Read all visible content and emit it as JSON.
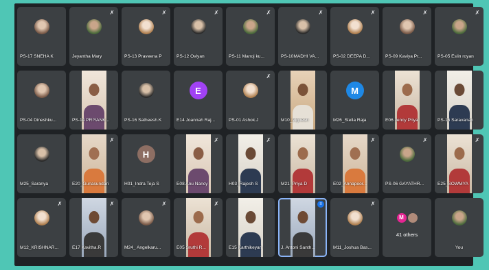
{
  "tiles": [
    {
      "name": "PS-17 SNEHA K",
      "kind": "avatar",
      "style": "photo1",
      "mic": ""
    },
    {
      "name": "Jeyantha Mary",
      "kind": "avatar",
      "style": "photo3",
      "mic": "muted"
    },
    {
      "name": "PS-13 Praveena P",
      "kind": "avatar",
      "style": "photo2",
      "mic": "muted"
    },
    {
      "name": "PS-12 Oviyan",
      "kind": "avatar",
      "style": "photo4",
      "mic": "muted"
    },
    {
      "name": "PS-11 Manoj ku...",
      "kind": "avatar",
      "style": "photo3",
      "mic": "muted"
    },
    {
      "name": "PS-10MADHI VA...",
      "kind": "avatar",
      "style": "photo4",
      "mic": "muted"
    },
    {
      "name": "PS-02 DEEPA D...",
      "kind": "avatar",
      "style": "photo2",
      "mic": "muted"
    },
    {
      "name": "PS-09 Kaviya Pr...",
      "kind": "avatar",
      "style": "photo1",
      "mic": "muted"
    },
    {
      "name": "PS-05 Eslin royan",
      "kind": "avatar",
      "style": "photo3",
      "mic": "muted"
    },
    {
      "name": "PS-04 Dineshku...",
      "kind": "avatar",
      "style": "photo1",
      "mic": ""
    },
    {
      "name": "PS-14 PRIYANK...",
      "kind": "video",
      "style": "v-b",
      "mic": ""
    },
    {
      "name": "PS-16 Satheesh.K",
      "kind": "avatar",
      "style": "photo4",
      "mic": ""
    },
    {
      "name": "E14 Joannah Raj...",
      "kind": "letter",
      "letter": "E",
      "color": "#a142f4",
      "mic": ""
    },
    {
      "name": "PS-01 Ashok.J",
      "kind": "avatar",
      "style": "photo2",
      "mic": "muted"
    },
    {
      "name": "M10_Vignesh",
      "kind": "video",
      "style": "v-c",
      "mic": ""
    },
    {
      "name": "M26_Stella Raja",
      "kind": "letter",
      "letter": "M",
      "color": "#1e88e5",
      "mic": ""
    },
    {
      "name": "E06 Jency Priya",
      "kind": "video",
      "style": "v-e",
      "mic": ""
    },
    {
      "name": "PS-15 Saravanan",
      "kind": "video",
      "style": "v-d",
      "mic": ""
    },
    {
      "name": "M25_Saranya",
      "kind": "avatar",
      "style": "photo4",
      "mic": ""
    },
    {
      "name": "E20_Gunasundari",
      "kind": "video",
      "style": "v-a",
      "mic": "muted"
    },
    {
      "name": "H01_Indra Teja S",
      "kind": "letter",
      "letter": "H",
      "color": "#8d6e63",
      "mic": ""
    },
    {
      "name": "E08 Anu Nancy",
      "kind": "video",
      "style": "v-b",
      "mic": "muted"
    },
    {
      "name": "H03_Rajesh S",
      "kind": "video",
      "style": "v-d",
      "mic": "muted"
    },
    {
      "name": "M21_Priya D",
      "kind": "video",
      "style": "v-e",
      "mic": ""
    },
    {
      "name": "E02_Annapoor...",
      "kind": "video",
      "style": "v-a",
      "mic": "muted"
    },
    {
      "name": "PS-06 GAYATHR...",
      "kind": "avatar",
      "style": "photo3",
      "mic": "muted"
    },
    {
      "name": "E25_SOWMYA",
      "kind": "video",
      "style": "v-e",
      "mic": "muted"
    },
    {
      "name": "M12_KRISHNAR...",
      "kind": "avatar",
      "style": "photo2",
      "mic": "muted"
    },
    {
      "name": "E17 Kavitha.R",
      "kind": "video",
      "style": "v-f",
      "mic": "muted"
    },
    {
      "name": "M24_ Angelkaru...",
      "kind": "avatar",
      "style": "photo1",
      "mic": "muted"
    },
    {
      "name": "E05 Sruthi R...",
      "kind": "video",
      "style": "v-e",
      "mic": "muted"
    },
    {
      "name": "E15 Karthikeyan",
      "kind": "video",
      "style": "v-d",
      "mic": ""
    },
    {
      "name": "J. Antoni Santh...",
      "kind": "video",
      "style": "v-f",
      "mic": "speaking",
      "speaking": true
    },
    {
      "name": "M11_Joshua Bas...",
      "kind": "avatar",
      "style": "photo2",
      "mic": "muted"
    },
    {
      "name": "41 others",
      "kind": "others",
      "letter": "M",
      "mic": ""
    },
    {
      "name": "You",
      "kind": "avatar",
      "style": "photo3",
      "mic": ""
    }
  ],
  "icons": {
    "muted": "mic-off-icon",
    "speaking": "audio-level-icon"
  },
  "colors": {
    "background": "#4fc6b5",
    "frame": "#1f2225",
    "tile": "#3c4043",
    "speaking_outline": "#8ab4f8"
  }
}
